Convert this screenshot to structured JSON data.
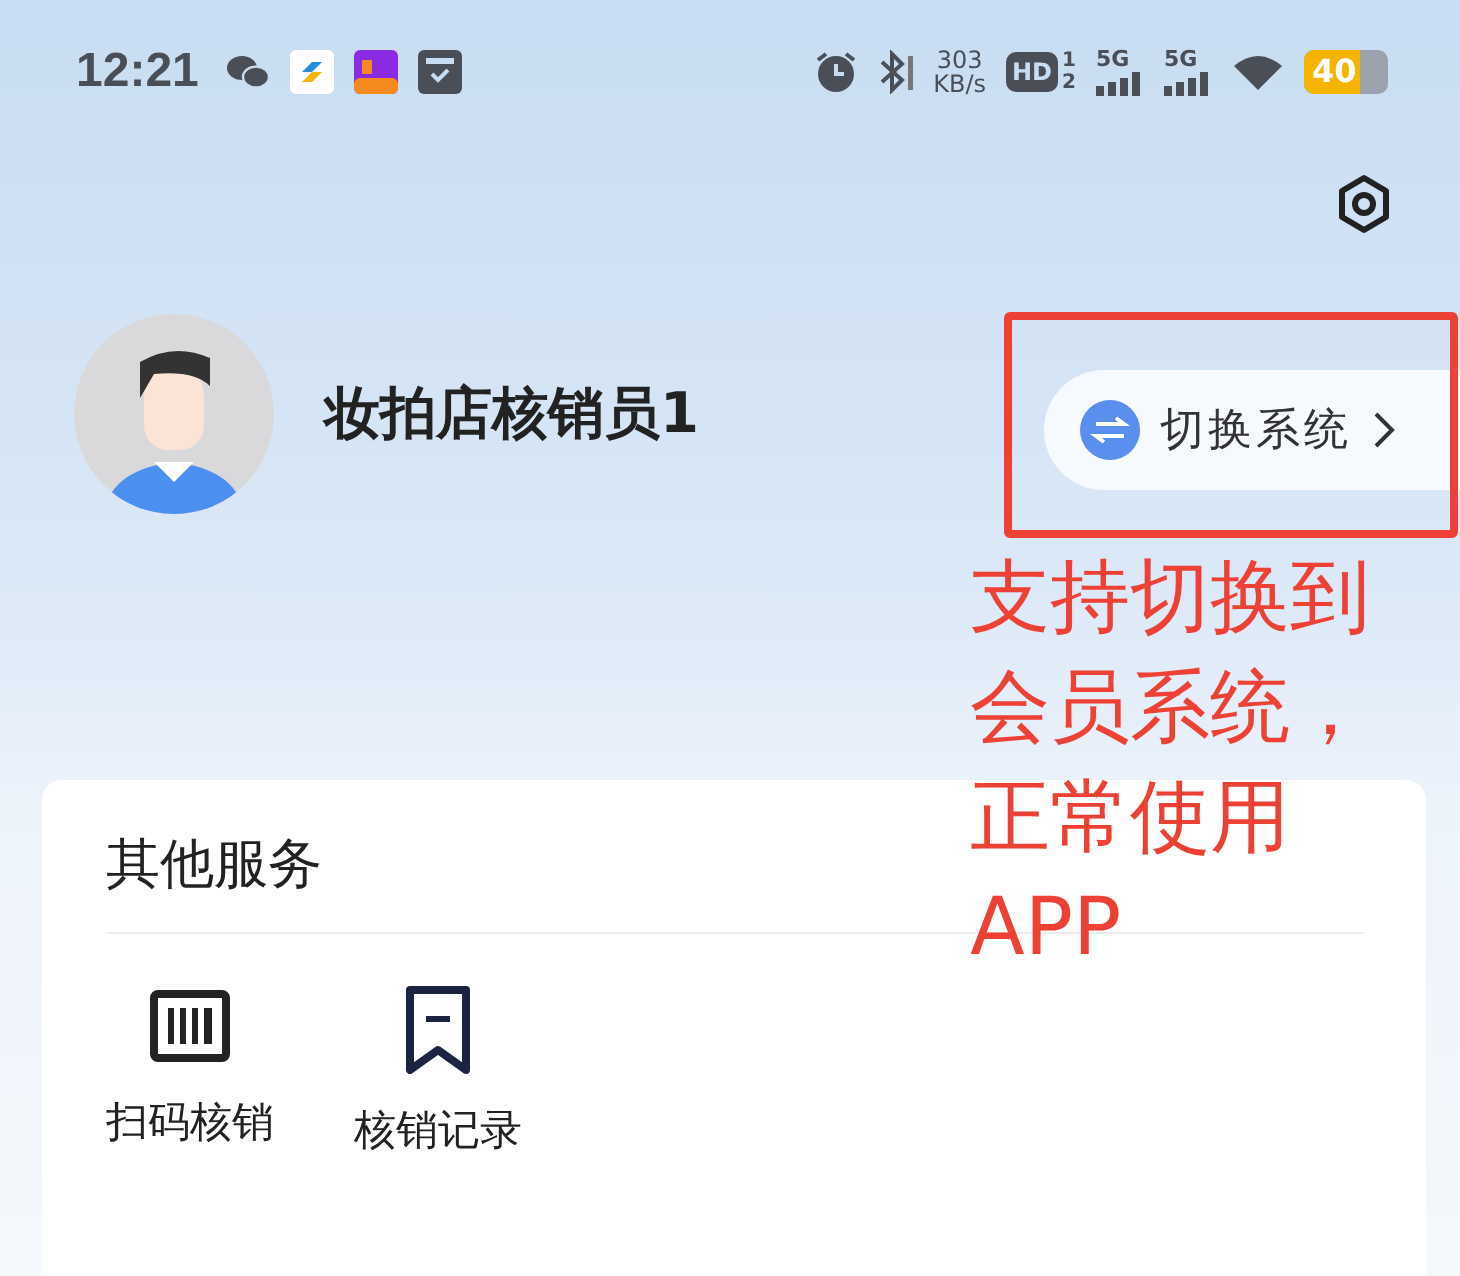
{
  "status_bar": {
    "time": "12:21",
    "speed_value": "303",
    "speed_unit": "KB/s",
    "hd": "HD",
    "sim_slots": [
      "1",
      "2"
    ],
    "networks": [
      "5G",
      "5G"
    ],
    "battery": "40"
  },
  "profile": {
    "name": "妆拍店核销员1",
    "switch_button": "切换系统"
  },
  "annotation": {
    "lines": [
      "支持切换到",
      "会员系统，",
      "正常使用",
      "APP"
    ]
  },
  "services": {
    "title": "其他服务",
    "items": [
      {
        "kind": "scan",
        "label": "扫码核销"
      },
      {
        "kind": "record",
        "label": "核销记录"
      }
    ]
  }
}
